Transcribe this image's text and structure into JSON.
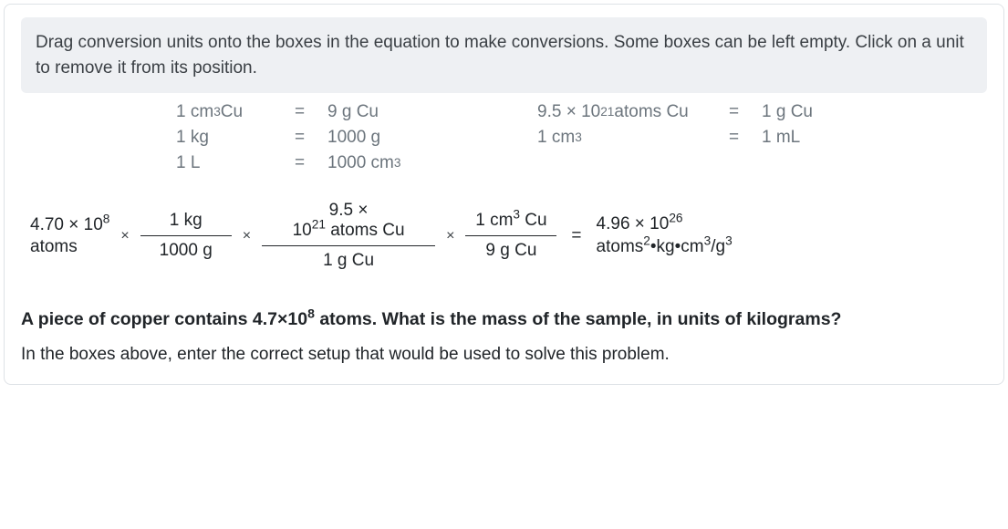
{
  "instructions": "Drag conversion units onto the boxes in the equation to make conversions. Some boxes can be left empty. Click on a unit to remove it from its position.",
  "facts": {
    "r1": {
      "left_a": "1 cm",
      "left_sup": "3",
      "left_b": " Cu",
      "right": "9 g Cu",
      "left2_a": "9.5 × 10",
      "left2_sup": "21",
      "left2_b": " atoms Cu",
      "right2": "1 g Cu"
    },
    "r2": {
      "left": "1 kg",
      "right": "1000 g",
      "left2_a": "1 cm",
      "left2_sup": "3",
      "right2": "1 mL"
    },
    "r3": {
      "left": "1 L",
      "right_a": "1000 cm",
      "right_sup": "3"
    }
  },
  "equation": {
    "start_line1": "4.70 × 10",
    "start_sup": "8",
    "start_line2": "atoms",
    "f1": {
      "num": "1 kg",
      "den": "1000 g"
    },
    "f2": {
      "num_l1": "9.5 ×",
      "num_l2a": "10",
      "num_l2sup": "21",
      "num_l2b": " atoms Cu",
      "den": "1 g Cu"
    },
    "f3": {
      "num_a": "1 cm",
      "num_sup": "3",
      "num_b": " Cu",
      "den": "9 g Cu"
    },
    "result_l1a": "4.96 × 10",
    "result_l1sup": "26",
    "result_l2a": "atoms",
    "result_l2sup1": "2",
    "result_l2b": "•kg•cm",
    "result_l2sup2": "3",
    "result_l2c": "/g",
    "result_l2sup3": "3"
  },
  "question": {
    "bold_a": "A piece of copper contains 4.7×10",
    "bold_sup": "8",
    "bold_b": " atoms. What is the mass of the sample, in units of kilograms?",
    "follow": "In the boxes above, enter the correct setup that would be used to solve this problem."
  },
  "sym": {
    "eq": "=",
    "mult": "×"
  }
}
